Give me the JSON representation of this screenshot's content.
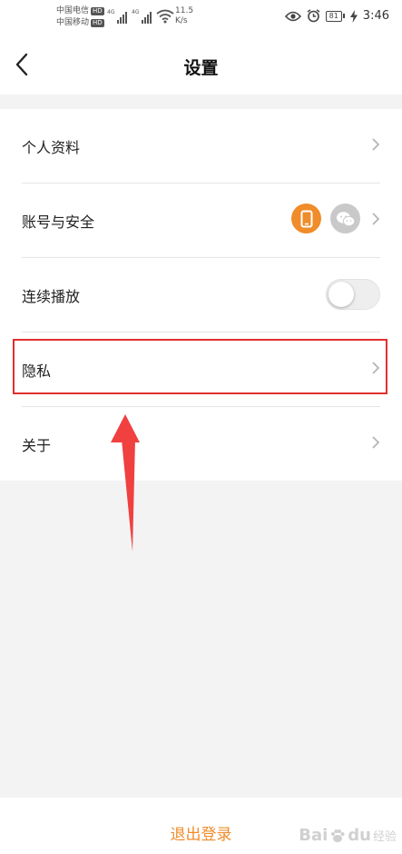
{
  "status_bar": {
    "carrier_1": "中国电信",
    "carrier_2": "中国移动",
    "hd_badge": "HD",
    "network_type": "4G",
    "speed_value": "11.5",
    "speed_unit": "K/s",
    "battery": "81",
    "time": "3:46"
  },
  "header": {
    "title": "设置"
  },
  "settings": {
    "items": [
      {
        "label": "个人资料"
      },
      {
        "label": "账号与安全"
      },
      {
        "label": "连续播放"
      },
      {
        "label": "隐私"
      },
      {
        "label": "关于"
      }
    ],
    "continuous_play_on": false
  },
  "logout_label": "退出登录",
  "watermark": {
    "brand": "Bai",
    "brand2": "du",
    "sub": "经验"
  },
  "colors": {
    "accent": "#f08c2a",
    "highlight": "#e0302e"
  }
}
